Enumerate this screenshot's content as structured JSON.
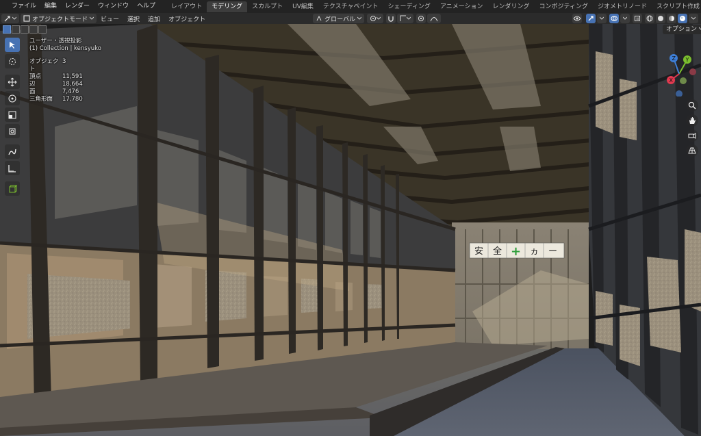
{
  "top_menu": {
    "items": [
      "ファイル",
      "編集",
      "レンダー",
      "ウィンドウ",
      "ヘルプ"
    ]
  },
  "workspaces": {
    "tabs": [
      "レイアウト",
      "モデリング",
      "スカルプト",
      "UV編集",
      "テクスチャペイント",
      "シェーディング",
      "アニメーション",
      "レンダリング",
      "コンポジティング",
      "ジオメトリノード",
      "スクリプト作成"
    ],
    "active": "モデリング",
    "add": "+"
  },
  "header": {
    "mode": "オブジェクトモード",
    "menus": [
      "ビュー",
      "選択",
      "追加",
      "オブジェクト"
    ],
    "transform_orientation": "グローバル",
    "options": "オプション"
  },
  "overlay": {
    "view_name": "ユーザー・透視投影",
    "collection": "(1) Collection | kensyuko",
    "stats": [
      {
        "label": "オブジェクト",
        "value": "3"
      },
      {
        "label": "頂点",
        "value": "11,591"
      },
      {
        "label": "辺",
        "value": "18,664"
      },
      {
        "label": "面",
        "value": "7,476"
      },
      {
        "label": "三角形面",
        "value": "17,780"
      }
    ]
  },
  "gizmo": {
    "x": "X",
    "y": "Y",
    "z": "Z"
  },
  "sign": [
    "安",
    "全",
    "+",
    "ヵ",
    "ー"
  ],
  "icons": {
    "toolbar": [
      "select-box-icon",
      "cursor-icon",
      "move-icon",
      "rotate-icon",
      "scale-icon",
      "transform-icon",
      "annotate-icon",
      "measure-icon",
      "add-cube-icon"
    ],
    "nav": [
      "zoom-icon",
      "hand-pan-icon",
      "camera-icon",
      "perspective-grid-icon"
    ]
  },
  "colors": {
    "accent": "#4772b3",
    "x_axis": "#e0394f",
    "y_axis": "#7bbf2e",
    "z_axis": "#3e7fd8",
    "sign_cross": "#2e9e3a"
  }
}
